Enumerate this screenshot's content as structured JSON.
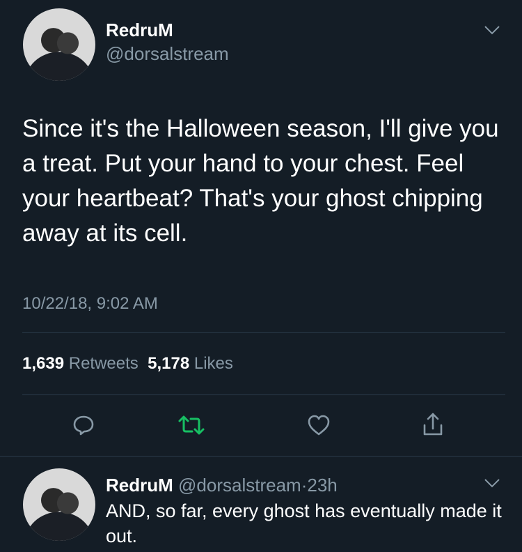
{
  "tweet": {
    "author_name": "RedruM",
    "author_handle": "@dorsalstream",
    "text": "Since it's the Halloween season, I'll give you a treat. Put your hand to your chest. Feel your heartbeat? That's your ghost chipping away at its cell.",
    "timestamp": "10/22/18, 9:02 AM",
    "retweets_count": "1,639",
    "retweets_label": "Retweets",
    "likes_count": "5,178",
    "likes_label": "Likes"
  },
  "reply": {
    "author_name": "RedruM",
    "author_handle": "@dorsalstream",
    "separator": "·",
    "age": "23h",
    "text": "AND, so far, every ghost has eventually made it out."
  },
  "icons": {
    "reply": "reply-icon",
    "retweet": "retweet-icon",
    "like": "heart-icon",
    "share": "share-icon",
    "menu": "chevron-down-icon"
  },
  "colors": {
    "background": "#141d26",
    "text": "#ffffff",
    "secondary": "#8899a6",
    "retweet_accent": "#17bf63",
    "divider": "#2a3a4a"
  }
}
